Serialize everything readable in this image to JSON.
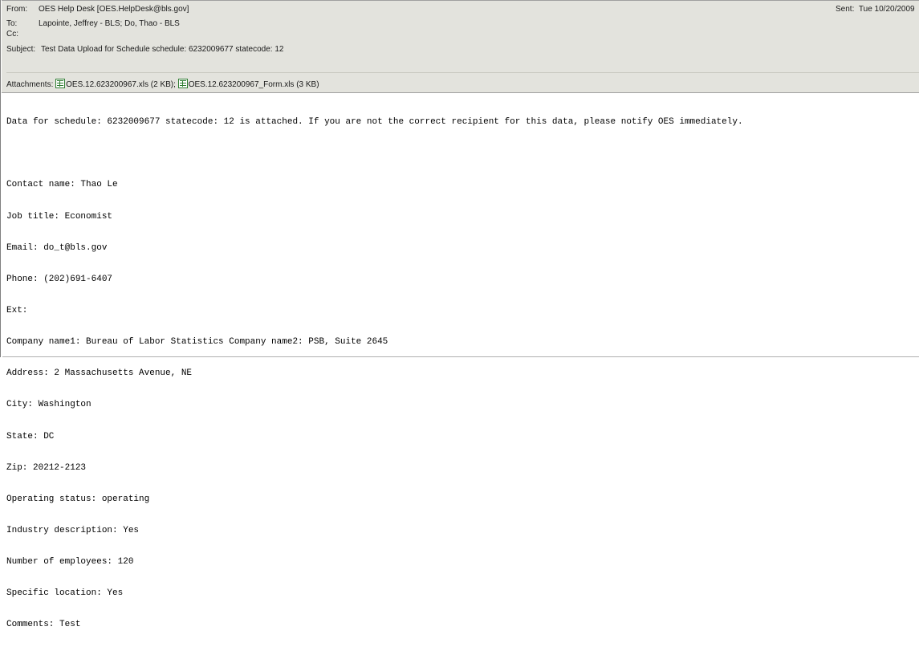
{
  "header": {
    "from_label": "From:",
    "from_value": "OES Help Desk [OES.HelpDesk@bls.gov]",
    "sent_label": "Sent:",
    "sent_value": "Tue 10/20/2009",
    "to_label": "To:",
    "to_value": "Lapointe, Jeffrey - BLS; Do, Thao - BLS",
    "cc_label": "Cc:",
    "cc_value": "",
    "subject_label": "Subject:",
    "subject_value": "Test Data Upload for Schedule schedule: 6232009677 statecode: 12",
    "attachments_label": "Attachments:",
    "attachments": [
      {
        "icon": "excel-file-icon",
        "name": "OES.12.623200967.xls (2 KB)"
      },
      {
        "icon": "excel-file-icon",
        "name": "OES.12.623200967_Form.xls (3 KB)"
      }
    ],
    "attachment_separator": ";"
  },
  "body": {
    "lines": [
      "Data for schedule: 6232009677 statecode: 12 is attached. If you are not the correct recipient for this data, please notify OES immediately.",
      "",
      "Contact name: Thao Le",
      "Job title: Economist",
      "Email: do_t@bls.gov",
      "Phone: (202)691-6407",
      "Ext:",
      "Company name1: Bureau of Labor Statistics Company name2: PSB, Suite 2645",
      "Address: 2 Massachusetts Avenue, NE",
      "City: Washington",
      "State: DC",
      "Zip: 20212-2123",
      "Operating status: operating",
      "Industry description: Yes",
      "Number of employees: 120",
      "Specific location: Yes",
      "Comments: Test"
    ]
  }
}
